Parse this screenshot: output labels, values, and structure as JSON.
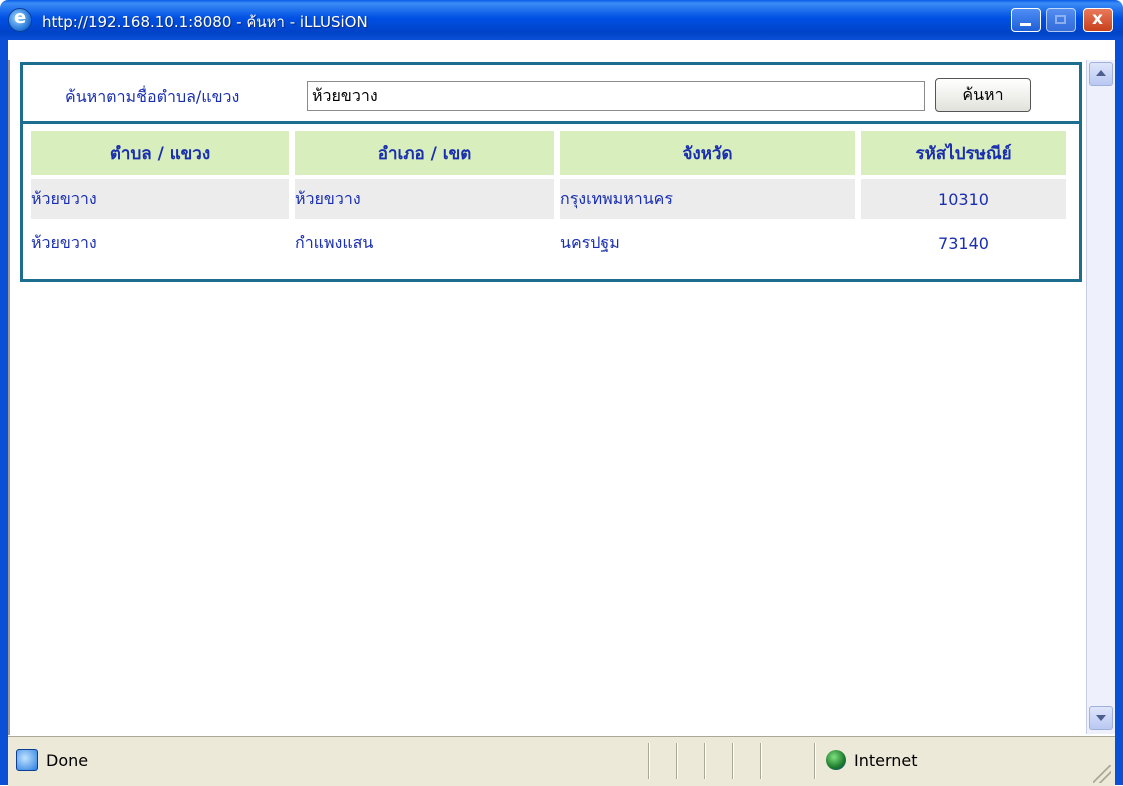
{
  "window": {
    "title": "http://192.168.10.1:8080 - ค้นหา - iLLUSiON"
  },
  "search": {
    "label": "ค้นหาตามชื่อตำบล/แขวง",
    "value": "ห้วยขวาง",
    "button_label": "ค้นหา"
  },
  "table": {
    "headers": [
      "ตำบล / แขวง",
      "อำเภอ / เขต",
      "จังหวัด",
      "รหัสไปรษณีย์"
    ],
    "rows": [
      [
        "ห้วยขวาง",
        "ห้วยขวาง",
        "กรุงเทพมหานคร",
        "10310"
      ],
      [
        "ห้วยขวาง",
        "กำแพงแสน",
        "นครปฐม",
        "73140"
      ]
    ]
  },
  "status": {
    "text": "Done",
    "zone": "Internet"
  },
  "colors": {
    "header_bg": "#d8eebc",
    "text_blue": "#1a2fb0",
    "border_teal": "#1d6d8f"
  }
}
